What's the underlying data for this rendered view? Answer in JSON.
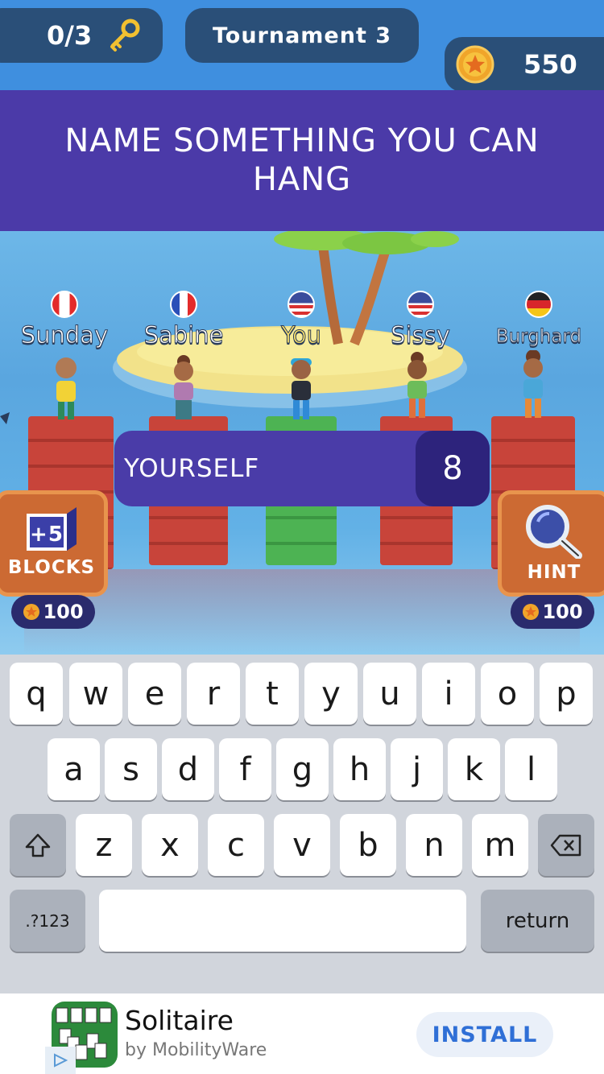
{
  "hud": {
    "keys_label": "0/3",
    "key_icon": "key-icon",
    "tournament_label": "Tournament 3",
    "coins_value": "550",
    "coin_icon": "star-coin-icon"
  },
  "question": {
    "text": "NAME SOMETHING YOU CAN HANG"
  },
  "players": [
    {
      "name": "Sunday",
      "flag": "canada"
    },
    {
      "name": "Sabine",
      "flag": "france"
    },
    {
      "name": "You",
      "flag": "usa"
    },
    {
      "name": "Sissy",
      "flag": "usa"
    },
    {
      "name": "Burghard",
      "flag": "germany"
    }
  ],
  "answer": {
    "word": "YOURSELF",
    "count": "8"
  },
  "powerups": {
    "blocks": {
      "badge": "+5",
      "label": "BLOCKS",
      "cost": "100"
    },
    "hint": {
      "label": "HINT",
      "cost": "100"
    }
  },
  "keyboard": {
    "row1": [
      "q",
      "w",
      "e",
      "r",
      "t",
      "y",
      "u",
      "i",
      "o",
      "p"
    ],
    "row2": [
      "a",
      "s",
      "d",
      "f",
      "g",
      "h",
      "j",
      "k",
      "l"
    ],
    "row3": [
      "z",
      "x",
      "c",
      "v",
      "b",
      "n",
      "m"
    ],
    "numbers_label": ".?123",
    "return_label": "return",
    "shift_icon": "shift-icon",
    "delete_icon": "delete-icon"
  },
  "ad": {
    "app_name": "Solitaire",
    "publisher": "by MobilityWare",
    "install_label": "INSTALL"
  },
  "colors": {
    "banner": "#4b3aa8",
    "hud_pill": "#2a4f78",
    "powerup": "#cc6a33",
    "tower_red": "#c8443a",
    "tower_green": "#4db353"
  }
}
